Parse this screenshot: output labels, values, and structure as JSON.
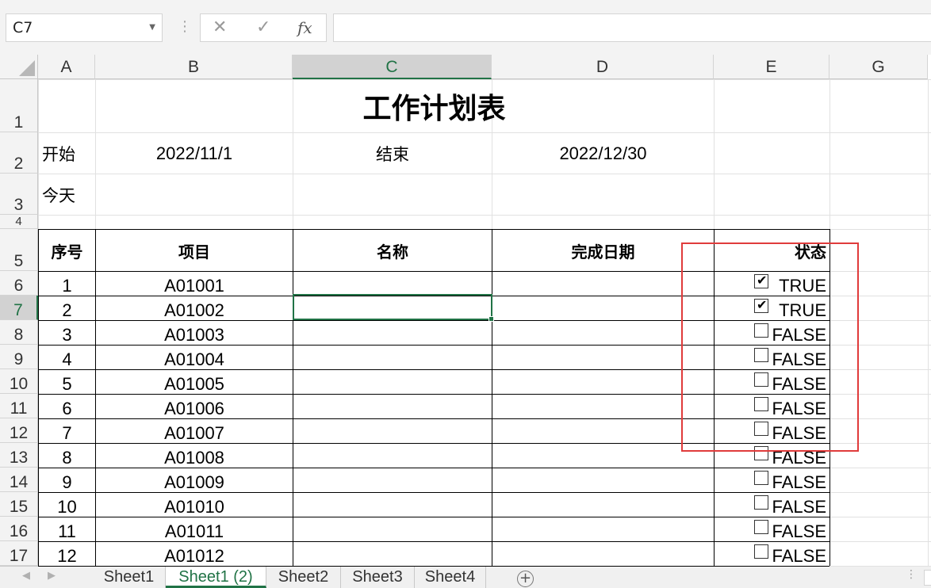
{
  "formula_bar": {
    "name_box": "C7",
    "fx_label": "fx",
    "formula_value": ""
  },
  "columns": [
    "A",
    "B",
    "C",
    "D",
    "E",
    "G"
  ],
  "rows": [
    "1",
    "2",
    "3",
    "4",
    "5",
    "6",
    "7",
    "8",
    "9",
    "10",
    "11",
    "12",
    "13",
    "14",
    "15",
    "16",
    "17"
  ],
  "sheet": {
    "title": "工作计划表",
    "start_label": "开始",
    "start_date": "2022/11/1",
    "end_label": "结束",
    "end_date": "2022/12/30",
    "today_label": "今天",
    "headers": [
      "序号",
      "项目",
      "名称",
      "完成日期",
      "状态"
    ],
    "table_rows": [
      {
        "no": "1",
        "item": "A01001",
        "status": "TRUE",
        "checked": true
      },
      {
        "no": "2",
        "item": "A01002",
        "status": "TRUE",
        "checked": true
      },
      {
        "no": "3",
        "item": "A01003",
        "status": "FALSE",
        "checked": false
      },
      {
        "no": "4",
        "item": "A01004",
        "status": "FALSE",
        "checked": false
      },
      {
        "no": "5",
        "item": "A01005",
        "status": "FALSE",
        "checked": false
      },
      {
        "no": "6",
        "item": "A01006",
        "status": "FALSE",
        "checked": false
      },
      {
        "no": "7",
        "item": "A01007",
        "status": "FALSE",
        "checked": false
      },
      {
        "no": "8",
        "item": "A01008",
        "status": "FALSE",
        "checked": false
      },
      {
        "no": "9",
        "item": "A01009",
        "status": "FALSE",
        "checked": false
      },
      {
        "no": "10",
        "item": "A01010",
        "status": "FALSE",
        "checked": false
      },
      {
        "no": "11",
        "item": "A01011",
        "status": "FALSE",
        "checked": false
      },
      {
        "no": "12",
        "item": "A01012",
        "status": "FALSE",
        "checked": false
      }
    ]
  },
  "tabs": [
    {
      "label": "Sheet1",
      "active": false
    },
    {
      "label": "Sheet1 (2)",
      "active": true
    },
    {
      "label": "Sheet2",
      "active": false
    },
    {
      "label": "Sheet3",
      "active": false
    },
    {
      "label": "Sheet4",
      "active": false
    }
  ],
  "colors": {
    "accent": "#217346",
    "header_fill": "#fce4d6",
    "highlight_box": "#e03b3b"
  },
  "icons": {
    "cancel": "close-icon",
    "enter": "check-icon",
    "function": "fx-icon",
    "add_sheet": "plus-icon"
  }
}
